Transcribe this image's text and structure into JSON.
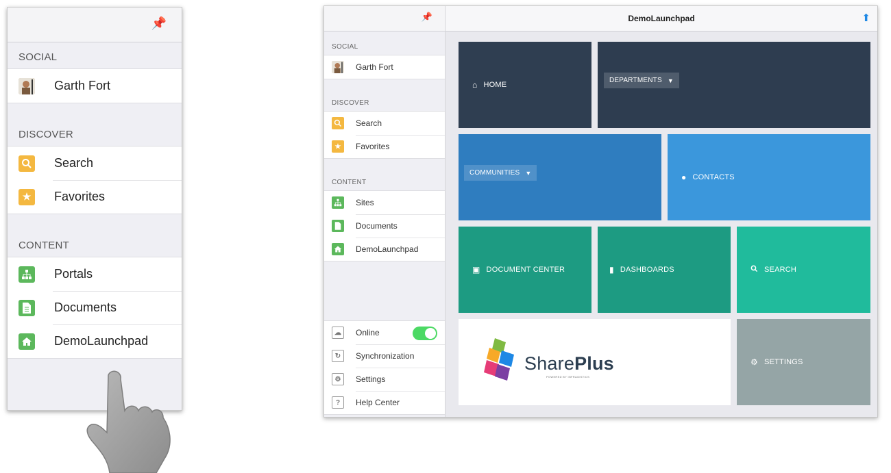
{
  "phone": {
    "sections": [
      {
        "label": "SOCIAL",
        "items": [
          {
            "label": "Garth Fort",
            "icon": "avatar"
          }
        ]
      },
      {
        "label": "DISCOVER",
        "items": [
          {
            "label": "Search",
            "icon": "search-icon",
            "color": "#f4b840"
          },
          {
            "label": "Favorites",
            "icon": "star-icon",
            "color": "#f4b840"
          }
        ]
      },
      {
        "label": "CONTENT",
        "items": [
          {
            "label": "Portals",
            "icon": "sitemap-icon",
            "color": "#5cb85c"
          },
          {
            "label": "Documents",
            "icon": "document-icon",
            "color": "#5cb85c"
          },
          {
            "label": "DemoLaunchpad",
            "icon": "home-icon",
            "color": "#5cb85c"
          }
        ]
      }
    ]
  },
  "tablet": {
    "title": "DemoLaunchpad",
    "sections": [
      {
        "label": "SOCIAL",
        "items": [
          {
            "label": "Garth Fort"
          }
        ]
      },
      {
        "label": "DISCOVER",
        "items": [
          {
            "label": "Search"
          },
          {
            "label": "Favorites"
          }
        ]
      },
      {
        "label": "CONTENT",
        "items": [
          {
            "label": "Sites"
          },
          {
            "label": "Documents"
          },
          {
            "label": "DemoLaunchpad"
          }
        ]
      }
    ],
    "bottom": [
      {
        "label": "Online",
        "toggle": true
      },
      {
        "label": "Synchronization"
      },
      {
        "label": "Settings"
      },
      {
        "label": "Help Center"
      }
    ],
    "tiles": {
      "home": "HOME",
      "departments": "DEPARTMENTS",
      "communities": "COMMUNITIES",
      "contacts": "CONTACTS",
      "document_center": "DOCUMENT CENTER",
      "dashboards": "DASHBOARDS",
      "search": "SEARCH",
      "settings": "SETTINGS"
    },
    "logo": {
      "text_a": "Share",
      "text_b": "Plus",
      "tagline": "POWERED BY INFRAGISTICS"
    }
  },
  "colors": {
    "home": "#2f3e51",
    "departments": "#2e3d50",
    "communities": "#2f7dbf",
    "contacts": "#3b97dc",
    "teal_dark": "#1d9b82",
    "teal_light": "#20bb9c",
    "settings": "#95a5a6",
    "toggle_on": "#4cd964"
  }
}
